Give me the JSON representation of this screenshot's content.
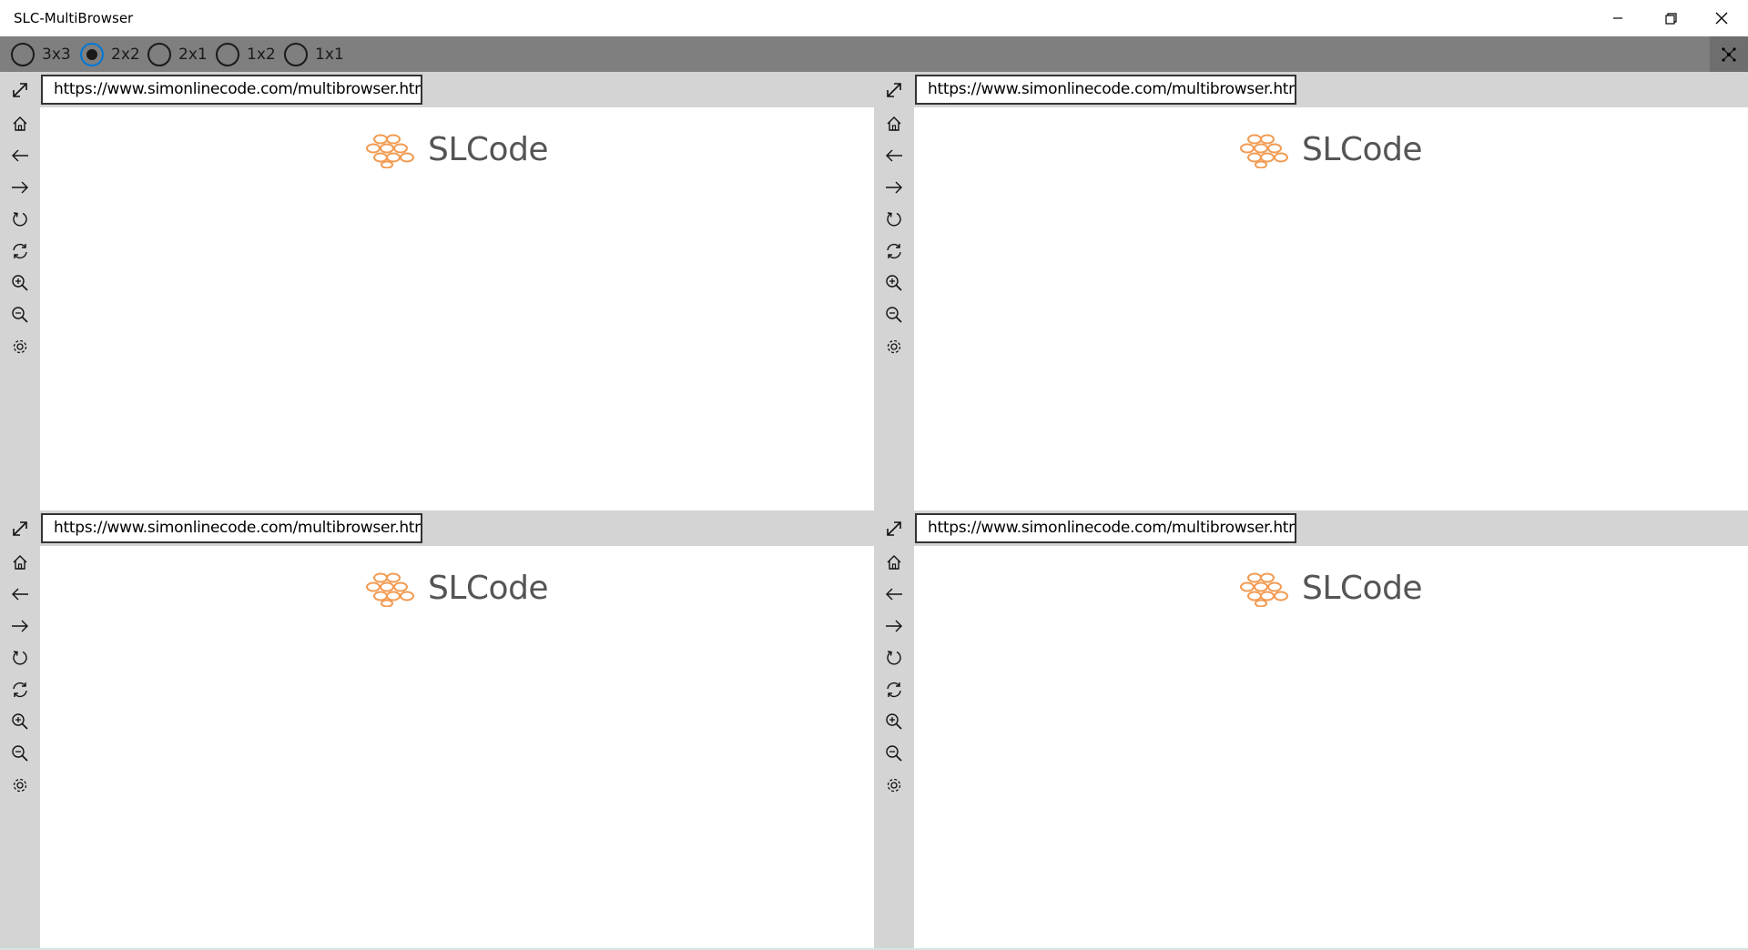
{
  "window": {
    "title": "SLC-MultiBrowser"
  },
  "layout_options": [
    {
      "label": "3x3",
      "selected": false
    },
    {
      "label": "2x2",
      "selected": true
    },
    {
      "label": "2x1",
      "selected": false
    },
    {
      "label": "1x2",
      "selected": false
    },
    {
      "label": "1x1",
      "selected": false
    }
  ],
  "panes": [
    {
      "url": "https://www.simonlinecode.com/multibrowser.html",
      "logo_text": "SLCode"
    },
    {
      "url": "https://www.simonlinecode.com/multibrowser.html",
      "logo_text": "SLCode"
    },
    {
      "url": "https://www.simonlinecode.com/multibrowser.html",
      "logo_text": "SLCode"
    },
    {
      "url": "https://www.simonlinecode.com/multibrowser.html",
      "logo_text": "SLCode"
    }
  ],
  "sidebar_icons": [
    "home-icon",
    "back-arrow-icon",
    "forward-arrow-icon",
    "reload-icon",
    "sync-icon",
    "zoom-in-icon",
    "zoom-out-icon",
    "settings-gear-icon"
  ],
  "colors": {
    "toolbar_gray": "#7f7f7f",
    "pane_gray": "#d4d4d4",
    "accent_blue": "#0078d7",
    "logo_orange": "#f29b52",
    "logo_text": "#555555"
  }
}
